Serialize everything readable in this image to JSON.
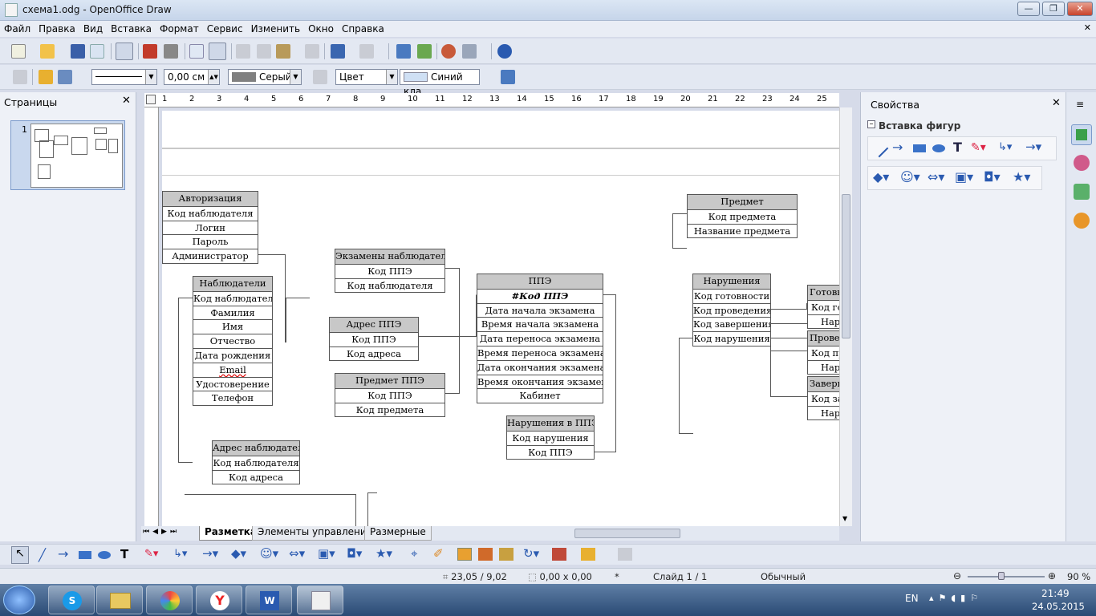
{
  "window": {
    "title": "схема1.odg - OpenOffice Draw"
  },
  "menu": [
    "Файл",
    "Правка",
    "Вид",
    "Вставка",
    "Формат",
    "Сервис",
    "Изменить",
    "Окно",
    "Справка"
  ],
  "line_toolbar": {
    "width_value": "0,00 см",
    "line_color": "Серый",
    "area_style": "Цвет",
    "area_color": "Синий кла"
  },
  "pages_panel": {
    "title": "Страницы",
    "page_number": "1"
  },
  "sidebar": {
    "title": "Свойства",
    "section": "Вставка фигур"
  },
  "ruler": {
    "top_ticks": [
      "1",
      "2",
      "3",
      "4",
      "5",
      "6",
      "7",
      "8",
      "9",
      "10",
      "11",
      "12",
      "13",
      "14",
      "15",
      "16",
      "17",
      "18",
      "19",
      "20",
      "21",
      "22",
      "23",
      "24",
      "25"
    ]
  },
  "tables": [
    {
      "title": "Авторизация",
      "rows": [
        "Код наблюдателя",
        "Логин",
        "Пароль",
        "Администратор"
      ]
    },
    {
      "title": "Наблюдатели",
      "rows": [
        "Код наблюдателя",
        "Фамилия",
        "Имя",
        "Отчество",
        "Дата рождения",
        "Email",
        "Удостоверение",
        "Телефон"
      ]
    },
    {
      "title": "Адрес наблюдателя",
      "rows": [
        "Код наблюдателя",
        "Код адреса"
      ]
    },
    {
      "title": "Экзамены наблюдателя",
      "rows": [
        "Код ППЭ",
        "Код наблюдателя"
      ]
    },
    {
      "title": "Адрес ППЭ",
      "rows": [
        "Код ППЭ",
        "Код адреса"
      ]
    },
    {
      "title": "Предмет ППЭ",
      "rows": [
        "Код ППЭ",
        "Код предмета"
      ]
    },
    {
      "title": "ППЭ",
      "rows": [
        "#Код ППЭ",
        "Дата начала экзамена",
        "Время начала экзамена",
        "Дата переноса экзамена",
        "Время переноса экзамена",
        "Дата окончания экзамена",
        "Время окончания экзамена",
        "Кабинет"
      ]
    },
    {
      "title": "Нарушения в ППЭ",
      "rows": [
        "Код нарушения",
        "Код ППЭ"
      ]
    },
    {
      "title": "Предмет",
      "rows": [
        "Код предмета",
        "Название предмета"
      ]
    },
    {
      "title": "Нарушения",
      "rows": [
        "Код готовности",
        "Код проведения",
        "Код завершения",
        "Код нарушения"
      ]
    },
    {
      "title": "Готовн",
      "rows": [
        "Код го",
        "Нару"
      ]
    },
    {
      "title": "Провед",
      "rows": [
        "Код пр",
        "Нару"
      ]
    },
    {
      "title": "Заверш",
      "rows": [
        "Код за",
        "Нару"
      ]
    }
  ],
  "tabs": [
    "Разметка",
    "Элементы управления",
    "Размерные"
  ],
  "status": {
    "position": "23,05 / 9,02",
    "size": "0,00 x 0,00",
    "modified": "*",
    "slide": "Слайд 1 / 1",
    "layout": "Обычный",
    "zoom": "90 %"
  },
  "taskbar": {
    "lang": "EN",
    "time": "21:49",
    "date": "24.05.2015"
  }
}
